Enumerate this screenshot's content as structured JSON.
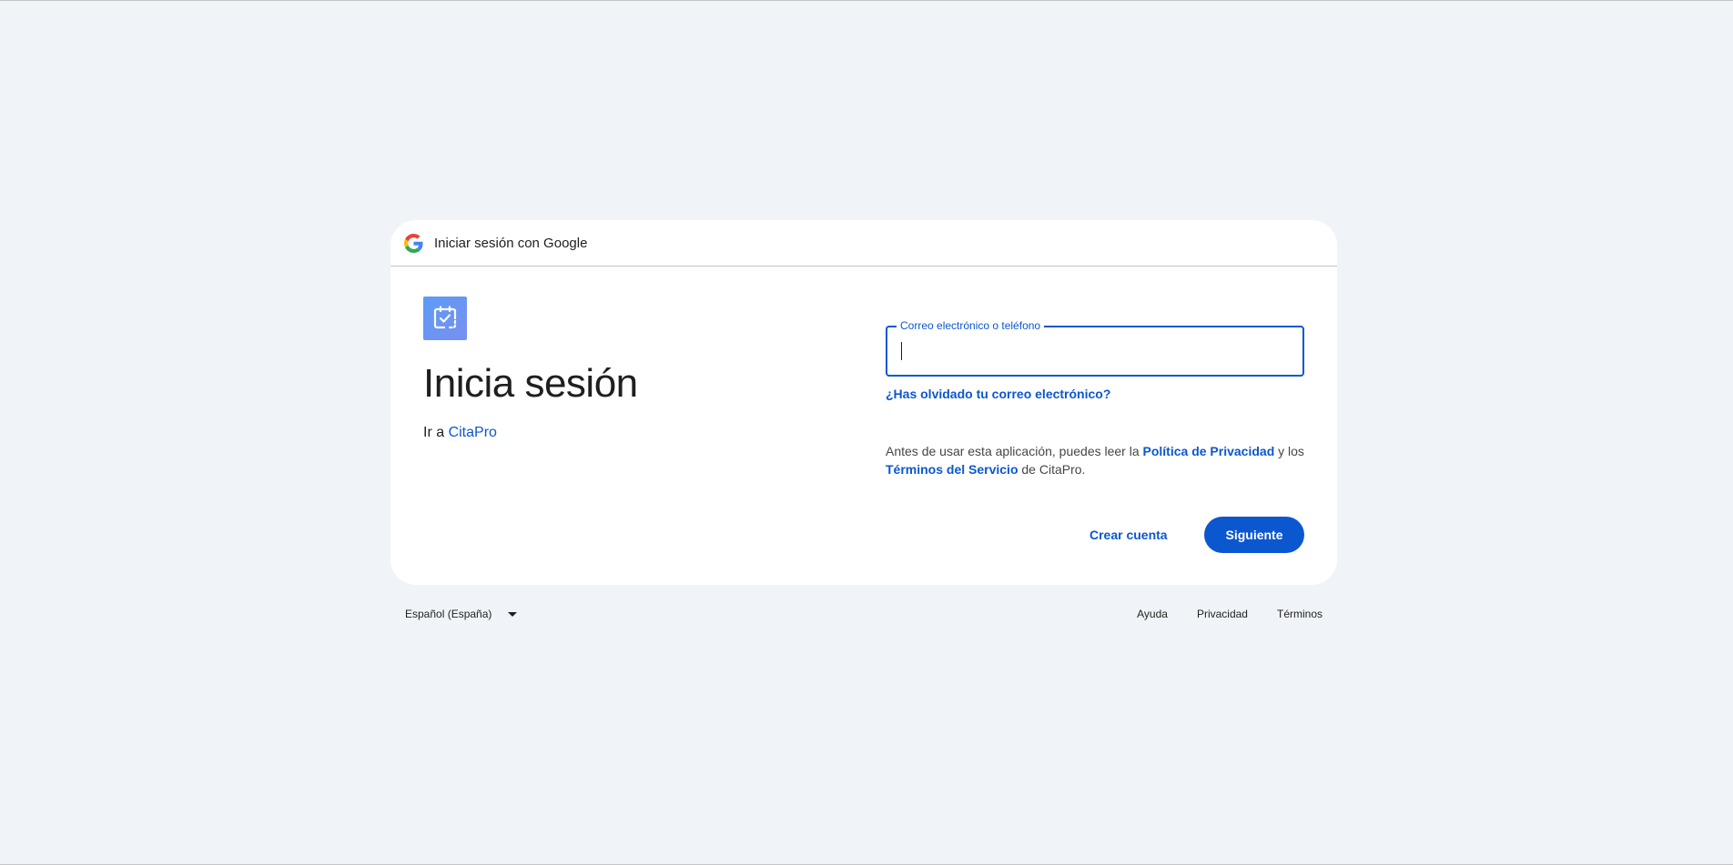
{
  "header": {
    "title": "Iniciar sesión con Google"
  },
  "main": {
    "title": "Inicia sesión",
    "subtitle_prefix": "Ir a ",
    "app_name": "CitaPro"
  },
  "email_field": {
    "label": "Correo electrónico o teléfono",
    "value": "",
    "placeholder": ""
  },
  "forgot_link": "¿Has olvidado tu correo electrónico?",
  "notice": {
    "text1": "Antes de usar esta aplicación, puedes leer la ",
    "privacy_link": "Política de Privacidad",
    "text2": " y los ",
    "terms_link": "Términos del Servicio",
    "text3": " de CitaPro."
  },
  "actions": {
    "create_account": "Crear cuenta",
    "next": "Siguiente"
  },
  "footer": {
    "language": "Español (España)",
    "help": "Ayuda",
    "privacy": "Privacidad",
    "terms": "Términos"
  },
  "colors": {
    "background": "#f0f4f9",
    "accent": "#0b57d0",
    "card": "#ffffff"
  },
  "icons": {
    "header_logo": "google-g-icon",
    "app_logo": "calendar-check-icon",
    "language_dropdown": "caret-down-icon"
  }
}
